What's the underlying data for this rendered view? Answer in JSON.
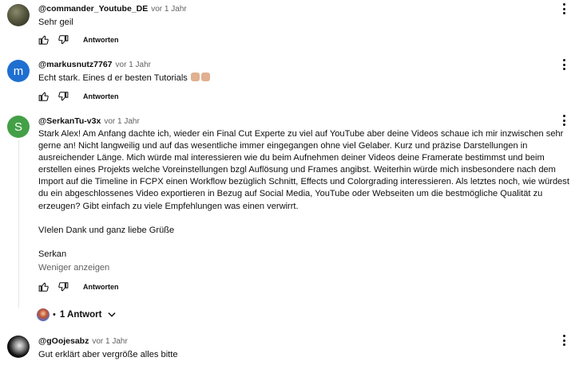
{
  "comments": [
    {
      "author": "@commander_Youtube_DE",
      "time": "vor 1 Jahr",
      "text": "Sehr geil",
      "reply_label": "Antworten"
    },
    {
      "author": "@markusnutz7767",
      "avatar_letter": "m",
      "time": "vor 1 Jahr",
      "text": "Echt stark.  Eines d er besten Tutorials",
      "emojis": [
        "thumbs-up-icon",
        "thumbs-up-icon"
      ],
      "reply_label": "Antworten"
    },
    {
      "author": "@SerkanTu-v3x",
      "avatar_letter": "S",
      "time": "vor 1 Jahr",
      "paragraphs": [
        "Stark Alex! Am Anfang dachte ich, wieder ein Final Cut Experte zu viel auf YouTube aber deine Videos schaue ich mir inzwischen sehr gerne an! Nicht langweilig und auf das wesentliche immer eingegangen ohne viel Gelaber. Kurz und präzise Darstellungen in ausreichender Länge. Mich würde mal interessieren wie du beim Aufnehmen deiner Videos deine Framerate bestimmst und beim erstellen eines Projekts welche Voreinstellungen bzgl Auflösung und Frames angibst. Weiterhin würde mich insbesondere nach dem Import auf die Timeline in FCPX einen Workflow bezüglich Schnitt, Effects und Colorgrading interessieren. Als letztes noch, wie würdest du  ein abgeschlossenes Video exportieren in Bezug auf Social Media, YouTube oder Webseiten um die bestmögliche Qualität zu erzeugen? Gibt einfach zu viele Empfehlungen was einen verwirrt.",
        "VIelen Dank und ganz liebe Grüße",
        "Serkan"
      ],
      "show_less": "Weniger anzeigen",
      "reply_label": "Antworten",
      "replies_label": "1 Antwort"
    },
    {
      "author": "@gOojesabz",
      "time": "vor 1 Jahr",
      "text": "Gut erklärt aber vergröße alles bitte"
    }
  ],
  "icons": {
    "like": "thumbs-up-icon",
    "dislike": "thumbs-down-icon",
    "menu": "more-vert-icon",
    "expand": "chevron-down-icon"
  },
  "colors": {
    "avatar_m": "#1f6fd1",
    "avatar_s": "#43a047",
    "text": "#0f0f0f",
    "muted": "#606060"
  }
}
